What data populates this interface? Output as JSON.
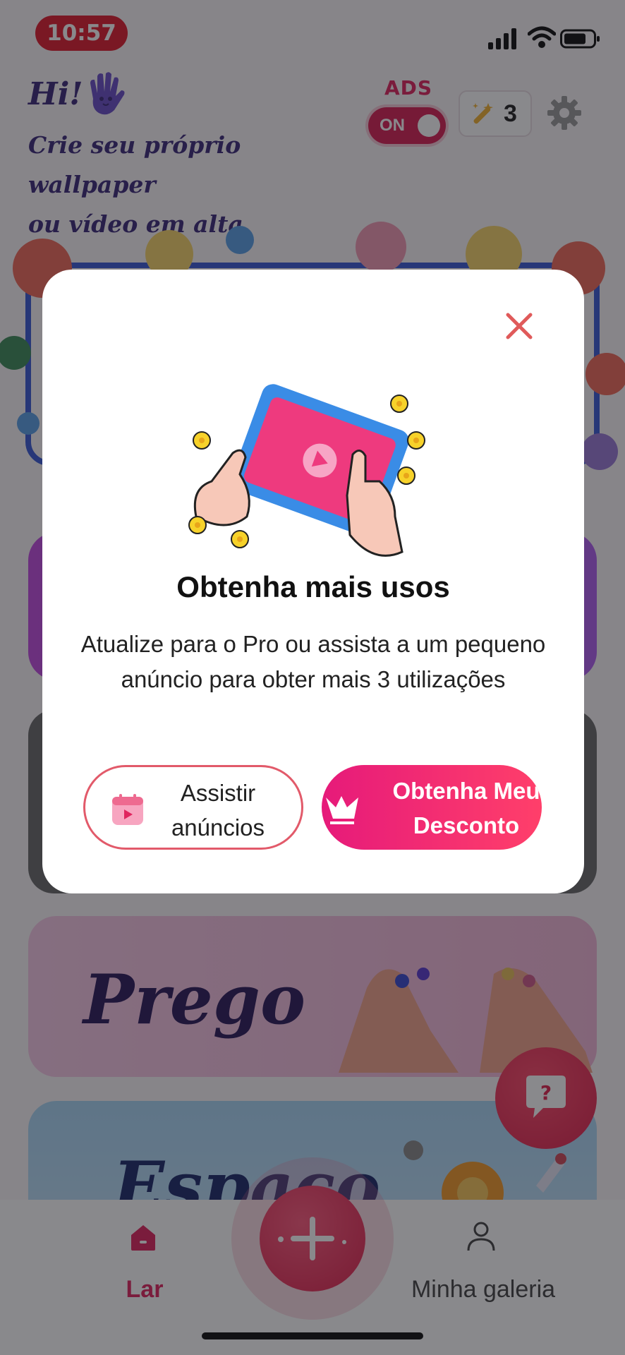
{
  "status_bar": {
    "time": "10:57"
  },
  "header": {
    "greeting": "Hi!",
    "subtitle_line1": "Crie seu próprio wallpaper",
    "subtitle_line2": "ou vídeo em alta",
    "ads_label": "ADS",
    "ads_toggle": "ON",
    "credits": "3"
  },
  "cards": {
    "nail_title": "Prego",
    "space_title": "Espaço"
  },
  "bottom_nav": {
    "home": "Lar",
    "gallery": "Minha galeria"
  },
  "modal": {
    "title": "Obtenha mais usos",
    "body": "Atualize para o Pro ou assista a um pequeno anúncio para obter mais 3 utilizações",
    "watch_line1": "Assistir",
    "watch_line2": "anúncios",
    "discount_line1": "Obtenha Meu",
    "discount_line2": "Desconto"
  },
  "colors": {
    "accent": "#e0245e",
    "header_text": "#3c2a7a",
    "overlay": "rgba(20,20,25,0.5)"
  }
}
